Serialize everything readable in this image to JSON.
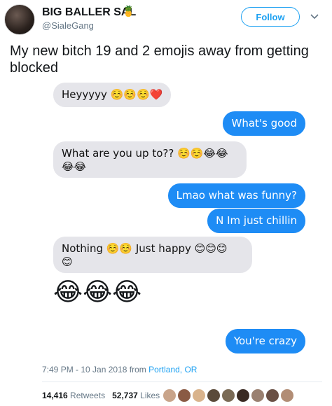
{
  "header": {
    "display_name": "BIG BALLER SAL",
    "name_emoji": "🍍",
    "handle": "@SialeGang",
    "follow_label": "Follow"
  },
  "tweet": {
    "text": "My new bitch 19 and 2 emojis away from getting blocked",
    "timestamp": "7:49 PM - 10 Jan 2018 from ",
    "location": "Portland, OR",
    "retweets_count": "14,416",
    "retweets_label": "Retweets",
    "likes_count": "52,737",
    "likes_label": "Likes"
  },
  "conversation": [
    {
      "side": "in",
      "text": "Heyyyyy ☺️☺️☺️❤️"
    },
    {
      "side": "out",
      "text": "What's good"
    },
    {
      "side": "in",
      "text": "What are you up to?? ☺️☺️😂😂"
    },
    {
      "side": "in",
      "text": "😂😂"
    },
    {
      "side": "out",
      "text": "Lmao what was funny?"
    },
    {
      "side": "out",
      "text": "N Im just chillin"
    },
    {
      "side": "in",
      "text": "Nothing ☺️☺️ Just happy 😊😊😊"
    },
    {
      "side": "in",
      "text": "😊"
    },
    {
      "side": "in",
      "text": "😂😂😂"
    },
    {
      "side": "out",
      "text": "You're crazy"
    }
  ],
  "colors": {
    "accent": "#1da1f2",
    "imessage_blue": "#1e8cf5",
    "imessage_gray": "#e5e5ea"
  },
  "likers": [
    "#c9a48a",
    "#8a5a44",
    "#d9b38c",
    "#5a4a3a",
    "#7a6a55",
    "#3a2a22",
    "#9a8070",
    "#6a5045",
    "#b28d75"
  ]
}
